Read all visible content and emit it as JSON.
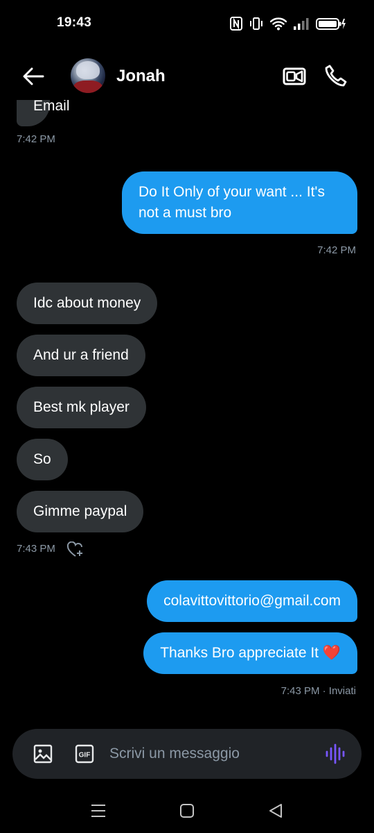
{
  "status_bar": {
    "time": "19:43"
  },
  "header": {
    "contact_name": "Jonah"
  },
  "messages": [
    {
      "side": "in",
      "text": "Email"
    },
    {
      "side": "meta",
      "text": "7:42 PM"
    },
    {
      "side": "out",
      "lines": [
        "Do It Only of your want ... It's",
        "not a must bro"
      ]
    },
    {
      "side": "meta",
      "text": "7:42 PM"
    },
    {
      "side": "in",
      "text": "Idc  about money"
    },
    {
      "side": "in",
      "text": "And ur a friend"
    },
    {
      "side": "in",
      "text": "Best mk player"
    },
    {
      "side": "in",
      "text": "So"
    },
    {
      "side": "in",
      "text": "Gimme paypal"
    },
    {
      "side": "meta",
      "text": "7:43 PM"
    },
    {
      "side": "out",
      "text": "colavittovittorio@gmail.com"
    },
    {
      "side": "out",
      "text": "Thanks Bro appreciate It ❤️"
    },
    {
      "side": "meta",
      "text": "7:43 PM · Inviati"
    }
  ],
  "composer": {
    "placeholder": "Scrivi un messaggio",
    "value": ""
  },
  "icons": {
    "back": "arrow-left-icon",
    "video_call": "video-camera-icon",
    "voice_call": "phone-icon",
    "react": "heart-plus-icon",
    "media": "image-icon",
    "gif": "gif-icon",
    "voice_message": "audio-wave-icon"
  },
  "colors": {
    "outgoing_bubble": "#1d9bf0",
    "incoming_bubble": "#2f3336",
    "accent_voice": "#7856ff",
    "timestamp": "#8b98a5"
  }
}
